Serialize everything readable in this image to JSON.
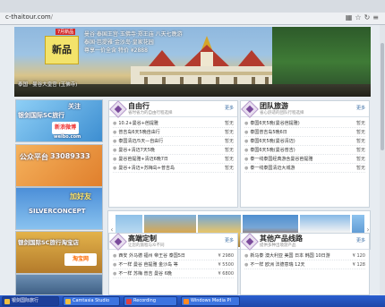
{
  "browser": {
    "url_main": "c-thaitour.com",
    "url_path": "/"
  },
  "banner": {
    "xinpin": "新品",
    "xinpin_tag": "7月新品",
    "promo_lines": [
      "曼谷·泰国王宫·玉佛寺·郑王庙 八天七晚游",
      "泰国·芭提雅·金沙岛·皇家花园",
      "尊享一价全含 特价 ¥2888"
    ],
    "caption": "泰国 · 曼谷大皇宫 (玉佛寺)"
  },
  "ads": {
    "ad1": {
      "line1": "关注",
      "line2": "银剑国际SC旅行",
      "badge": "新浪微博",
      "sub": "weibo.com"
    },
    "ad2": {
      "line1": "公众平台",
      "line2": "33089333"
    },
    "ad3": {
      "line1": "加好友",
      "line2": "SILVERCONCEPT"
    },
    "ad4": {
      "line1": "银剑国际SC旅行淘宝店",
      "line2": "淘宝网"
    },
    "ad5": {
      "line1": ""
    }
  },
  "panels": {
    "free": {
      "title": "自由行",
      "subtitle": "省时省力的自由行程选择",
      "more": "更多",
      "items": [
        {
          "text": "10.2+曼谷+芭提雅",
          "price": "暂无"
        },
        {
          "text": "普吉岛6天5晚自由行",
          "price": "暂无"
        },
        {
          "text": "泰国清迈/5天—自由行",
          "price": "暂无"
        },
        {
          "text": "曼谷+清迈7天5晚",
          "price": "暂无"
        },
        {
          "text": "曼谷芭提雅+清迈6晚7日",
          "price": "暂无"
        },
        {
          "text": "曼谷+清迈+苏梅岛+普吉岛",
          "price": "暂无"
        }
      ]
    },
    "group": {
      "title": "团队旅游",
      "subtitle": "省心舒适的团队行程选择",
      "more": "更多",
      "items": [
        {
          "text": "泰国6天5晚(曼谷芭提雅)",
          "price": "暂无"
        },
        {
          "text": "泰国普吉岛5晚6日",
          "price": "暂无"
        },
        {
          "text": "泰国6天5晚(曼谷清迈)",
          "price": "暂无"
        },
        {
          "text": "泰国6天5晚(曼谷普吉)",
          "price": "暂无"
        },
        {
          "text": "泰一线泰国经典游含曼谷芭提雅",
          "price": "暂无"
        },
        {
          "text": "泰一线泰国清迈大城游",
          "price": "暂无"
        }
      ]
    },
    "custom": {
      "title": "高端定制",
      "subtitle": "让您的旅程与众不同",
      "more": "更多",
      "items": [
        {
          "text": "西安 外马德 福州 帝王谷 泰国5日",
          "price": "¥ 2980"
        },
        {
          "text": "不一样 曼谷 芭提雅 金沙岛 等",
          "price": "¥ 5500"
        },
        {
          "text": "不一样 苏梅 普吉 曼谷 6晚",
          "price": "¥ 6800"
        }
      ]
    },
    "other": {
      "title": "其他产品线路",
      "subtitle": "提供多种出境游产品",
      "more": "更多",
      "items": [
        {
          "text": "新马泰 澳大利亚 美国 日本 韩国 10日游",
          "price": "¥ 120"
        },
        {
          "text": "不一样 欧洲 法德意瑞 12天",
          "price": "¥ 128"
        },
        {
          "text": "",
          "price": ""
        }
      ]
    }
  },
  "taskbar": {
    "items": [
      "银剑国际旅行",
      "Camtasia Studio",
      "Recording",
      "Windows Media Pl"
    ]
  },
  "colors": {
    "taskbar": "#2a5fd0",
    "panel_icon": "#7a4a9b",
    "link": "#3a6ea5"
  }
}
